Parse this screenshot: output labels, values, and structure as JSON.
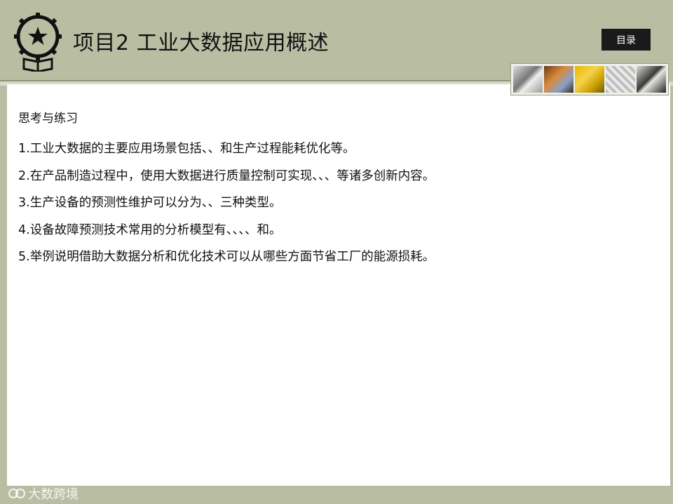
{
  "header": {
    "title": "项目2  工业大数据应用概述",
    "menu_label": "目录"
  },
  "content": {
    "subtitle": "思考与练习",
    "items": [
      "1.工业大数据的主要应用场景包括、、和生产过程能耗优化等。",
      "2.在产品制造过程中，使用大数据进行质量控制可实现、、、等诸多创新内容。",
      "3.生产设备的预测性维护可以分为、、三种类型。",
      "4.设备故障预测技术常用的分析模型有、、、、和。",
      "5.举例说明借助大数据分析和优化技术可以从哪些方面节省工厂的能源损耗。"
    ]
  },
  "watermark": {
    "text": "大数跨境"
  },
  "icons": [
    "emblem-logo-icon",
    "watermark-logo-icon"
  ],
  "colors": {
    "header_bg": "#b9bea3",
    "menu_button_bg": "#1a1a1a",
    "content_bg": "#ffffff"
  }
}
